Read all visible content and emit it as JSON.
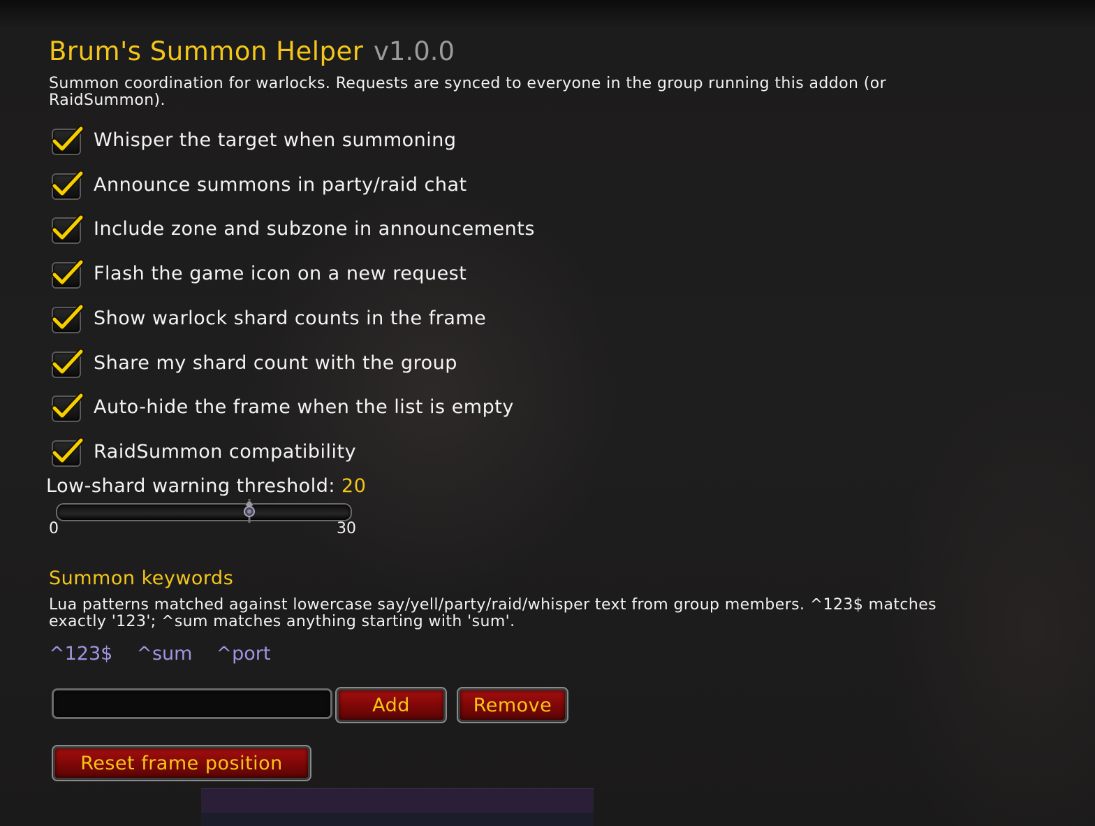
{
  "header": {
    "title": "Brum's Summon Helper",
    "version": "v1.0.0",
    "description": "Summon coordination for warlocks. Requests are synced to everyone in the group running this addon (or RaidSummon)."
  },
  "options": [
    {
      "label": "Whisper the target when summoning",
      "checked": true
    },
    {
      "label": "Announce summons in party/raid chat",
      "checked": true
    },
    {
      "label": "Include zone and subzone in announcements",
      "checked": true
    },
    {
      "label": "Flash the game icon on a new request",
      "checked": true
    },
    {
      "label": "Show warlock shard counts in the frame",
      "checked": true
    },
    {
      "label": "Share my shard count with the group",
      "checked": true
    },
    {
      "label": "Auto-hide the frame when the list is empty",
      "checked": true
    },
    {
      "label": "RaidSummon compatibility",
      "checked": true
    }
  ],
  "slider": {
    "label": "Low-shard warning threshold:",
    "value": "20",
    "min": "0",
    "max": "30"
  },
  "keywords_section": {
    "title": "Summon keywords",
    "description": "Lua patterns matched against lowercase say/yell/party/raid/whisper text from group members. ^123$ matches exactly '123'; ^sum matches anything starting with 'sum'.",
    "keywords": [
      "^123$",
      "^sum",
      "^port"
    ],
    "input_value": "",
    "add_label": "Add",
    "remove_label": "Remove"
  },
  "reset_label": "Reset frame position",
  "colors": {
    "accent_gold": "#f3c619",
    "keyword_purple": "#9f95e0",
    "button_red": "#8a0a0a"
  }
}
